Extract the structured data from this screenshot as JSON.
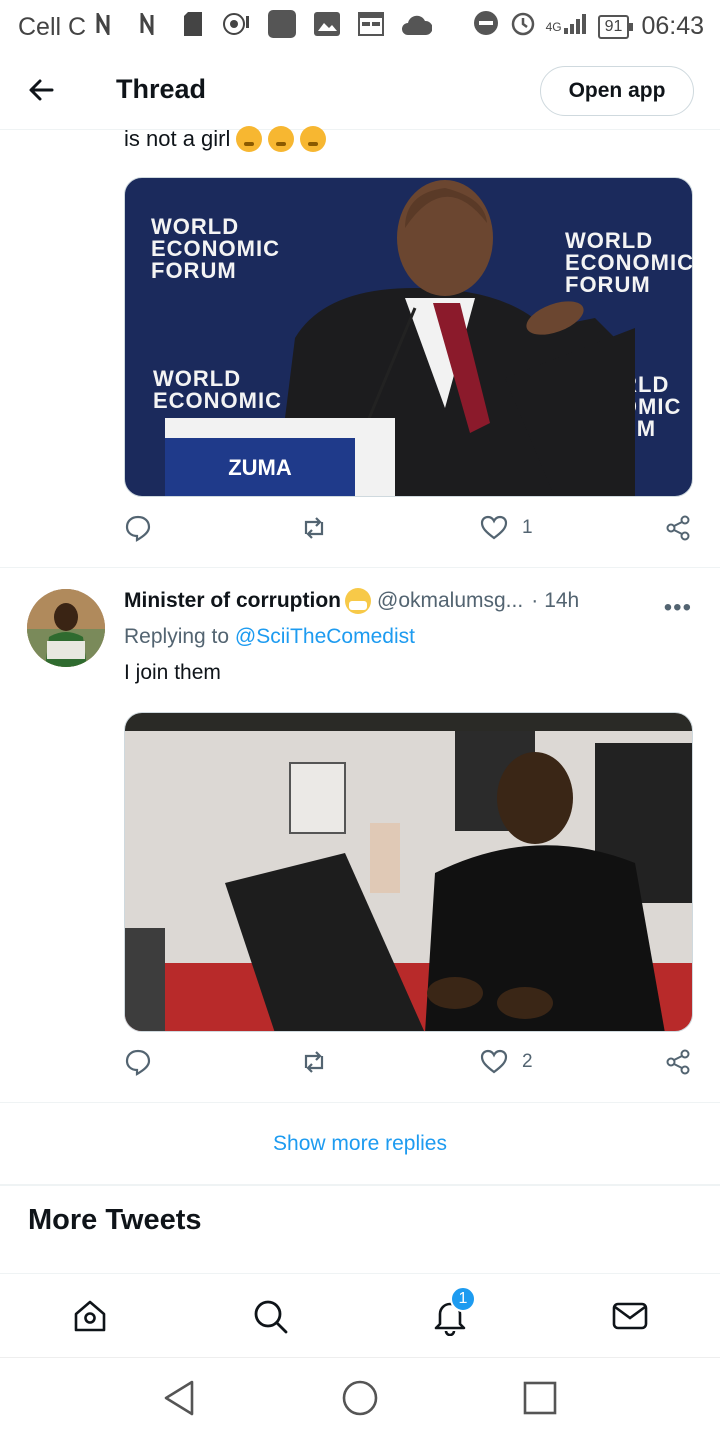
{
  "status_bar": {
    "carrier": "Cell C",
    "network": "4G",
    "battery": "91",
    "time": "06:43"
  },
  "header": {
    "title": "Thread",
    "open_app_label": "Open app"
  },
  "previous_tweet": {
    "text_tail": "is not a girl",
    "media": {
      "banner_text": "WORLD ECONOMIC FORUM",
      "podium_name": "ZUMA"
    },
    "replies": "",
    "retweets": "",
    "likes": "1"
  },
  "reply_tweet": {
    "display_name": "Minister of corruption",
    "handle": "@okmalumsg...",
    "separator": "·",
    "time": "14h",
    "more": "•••",
    "replying_label": "Replying to",
    "replying_to": "@SciiTheComedist",
    "text": "I join them",
    "replies": "",
    "retweets": "",
    "likes": "2"
  },
  "show_more_replies": "Show more replies",
  "more_tweets_title": "More Tweets",
  "bottom_nav": {
    "notifications_badge": "1"
  },
  "colors": {
    "accent": "#1d9bf0",
    "text": "#0f1419",
    "secondary": "#536471"
  }
}
